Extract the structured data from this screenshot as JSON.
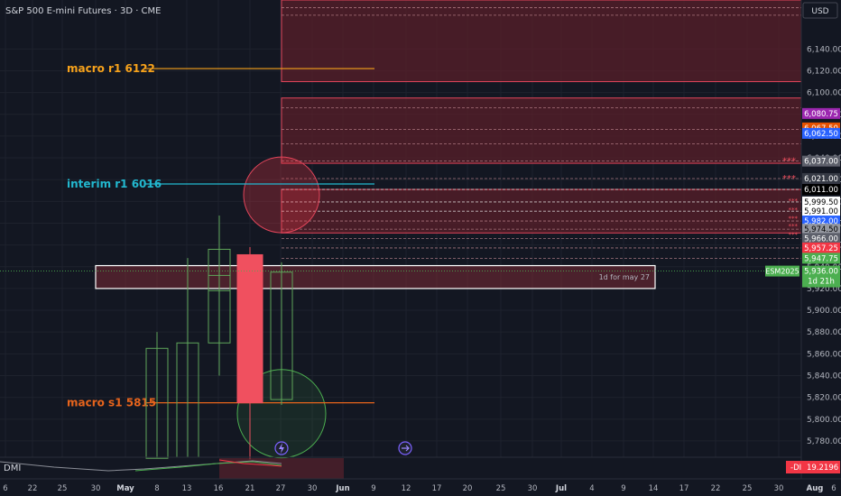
{
  "header": {
    "symbol_title": "S&P 500 E-mini Futures · 3D · CME",
    "currency": "USD"
  },
  "colors": {
    "background": "#131722",
    "grid": "#1e222d",
    "zone_fill": "#f2364533",
    "zone_stroke": "#e0455a",
    "macro_r1": "#f7a21b",
    "interim_r1": "#22b8cf",
    "macro_s1": "#e7641c",
    "candle_up": "#5fa55a",
    "candle_down": "#f0505f",
    "ema_line": "#8a8d96"
  },
  "chart_data": {
    "type": "candlestick",
    "title": "",
    "ylim": [
      5765,
      6185
    ],
    "y_ticks": [
      6140,
      6120,
      6100,
      6080,
      6060,
      6040,
      6020,
      6000,
      5980,
      5960,
      5940,
      5920,
      5900,
      5880,
      5860,
      5840,
      5820,
      5800,
      5780
    ],
    "y_tick_labels": [
      "6,140.00",
      "6,120.00",
      "6,100.00",
      "6,080.00",
      "6,060.00",
      "6,040.00",
      "6,020.00",
      "6,000.00",
      "5,980.00",
      "5,960.00",
      "5,940.00",
      "5,920.00",
      "5,900.00",
      "5,880.00",
      "5,860.00",
      "5,840.00",
      "5,820.00",
      "5,800.00",
      "5,780.00"
    ],
    "x_tick_labels": [
      "6",
      "22",
      "25",
      "30",
      "May",
      "8",
      "13",
      "16",
      "21",
      "27",
      "30",
      "Jun",
      "9",
      "12",
      "17",
      "20",
      "25",
      "30",
      "Jul",
      "4",
      "9",
      "14",
      "17",
      "22",
      "25",
      "30",
      "Aug",
      "6"
    ],
    "x_tick_bold": [
      "May",
      "Jun",
      "Jul",
      "Aug"
    ],
    "candles": [
      {
        "o": 5764,
        "h": 5880,
        "l": 5764,
        "c": 5865
      },
      {
        "o": 5765,
        "h": 5948,
        "l": 5765,
        "c": 5870
      },
      {
        "o": 5870,
        "h": 5944,
        "l": 5840,
        "c": 5932
      },
      {
        "o": 5918,
        "h": 5987,
        "l": 5898,
        "c": 5956
      },
      {
        "o": 5951,
        "h": 5958,
        "l": 5763,
        "c": 5815
      },
      {
        "o": 5818,
        "h": 5944,
        "l": 5813,
        "c": 5935
      }
    ],
    "levels": [
      {
        "name": "macro r1",
        "value": 6122,
        "label": "macro r1 6122"
      },
      {
        "name": "interim r1",
        "value": 6016,
        "label": "interim r1 6016"
      },
      {
        "name": "macro s1",
        "value": 5815,
        "label": "macro s1 5815"
      }
    ],
    "zones": [
      {
        "top": 6185,
        "bottom": 6110
      },
      {
        "top": 6095,
        "bottom": 6035
      },
      {
        "top": 6011,
        "bottom": 5971
      },
      {
        "top": 5941,
        "bottom": 5920,
        "highlight": true
      }
    ],
    "zone_note": "1d for may 27",
    "dashed_levels": [
      6178,
      6171,
      6086,
      6066,
      6053,
      6037,
      6021,
      6011,
      5999.5,
      5991,
      5982,
      5974.5,
      5966,
      5957.25,
      5947.75
    ],
    "price_badges": [
      {
        "value": 6080.75,
        "label": "6,080.75",
        "color": "#9c27b0",
        "text_color": "#ffffff"
      },
      {
        "value": 6067.5,
        "label": "6,067.50",
        "color": "#e65100",
        "text_color": "#ffffff"
      },
      {
        "value": 6062.5,
        "label": "6,062.50",
        "color": "#2962ff",
        "text_color": "#ffffff"
      },
      {
        "value": 6037,
        "label": "6,037.00",
        "color": "#5d606b",
        "text_color": "#ffffff"
      },
      {
        "value": 6021,
        "label": "6,021.00",
        "color": "#363a45",
        "text_color": "#ffffff"
      },
      {
        "value": 6011,
        "label": "6,011.00",
        "color": "#000000",
        "text_color": "#ffffff"
      },
      {
        "value": 5999.5,
        "label": "5,999.50",
        "color": "#ffffff",
        "text_color": "#000000"
      },
      {
        "value": 5991,
        "label": "5,991.00",
        "color": "#ffffff",
        "text_color": "#000000"
      },
      {
        "value": 5982,
        "label": "5,982.00",
        "color": "#2962ff",
        "text_color": "#ffffff"
      },
      {
        "value": 5974.5,
        "label": "5,974.50",
        "color": "#9598a1",
        "text_color": "#000000"
      },
      {
        "value": 5966,
        "label": "5,966.00",
        "color": "#5d606b",
        "text_color": "#ffffff"
      },
      {
        "value": 5957.25,
        "label": "5,957.25",
        "color": "#f23645",
        "text_color": "#ffffff"
      },
      {
        "value": 5947.75,
        "label": "5,947.75",
        "color": "#4caf50",
        "text_color": "#ffffff"
      },
      {
        "value": 5936,
        "label": "5,936.00",
        "color": "#4caf50",
        "text_color": "#ffffff"
      }
    ],
    "current_price": {
      "value": 5936,
      "symbol_tag": "ESM2025",
      "countdown": "1d 21h"
    },
    "stars": [
      "***",
      "***",
      "***",
      "***",
      "***",
      "***",
      "***"
    ],
    "indicator": {
      "name": "DMI",
      "minus_di_label": "-DI",
      "minus_di_value": "19.2196"
    }
  }
}
